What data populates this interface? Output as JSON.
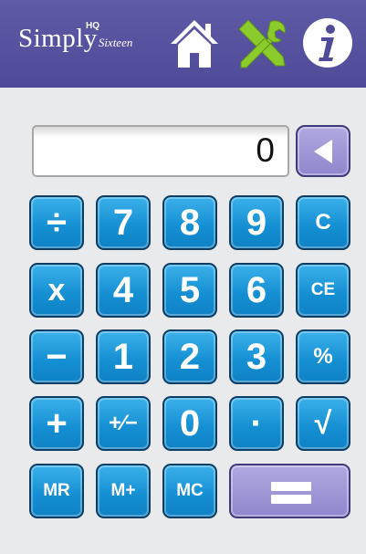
{
  "header": {
    "logo_hq": "HQ",
    "logo_main": "Simply",
    "logo_sub": "Sixteen",
    "icons": [
      "home-icon",
      "tools-icon",
      "info-icon"
    ],
    "color": "#5f5aa6"
  },
  "display": {
    "value": "0"
  },
  "keys": {
    "divide": "÷",
    "seven": "7",
    "eight": "8",
    "nine": "9",
    "clear": "C",
    "multiply": "x",
    "four": "4",
    "five": "5",
    "six": "6",
    "clear_entry": "CE",
    "minus": "−",
    "one": "1",
    "two": "2",
    "three": "3",
    "percent": "%",
    "plus": "+",
    "plus_minus": "+∕−",
    "zero": "0",
    "decimal": "·",
    "sqrt": "√",
    "memory_recall": "MR",
    "memory_add": "M+",
    "memory_clear": "MC",
    "equals": "="
  },
  "colors": {
    "key_blue": "#1a93d6",
    "key_purple": "#9a91d4",
    "background": "#e9eaec"
  }
}
